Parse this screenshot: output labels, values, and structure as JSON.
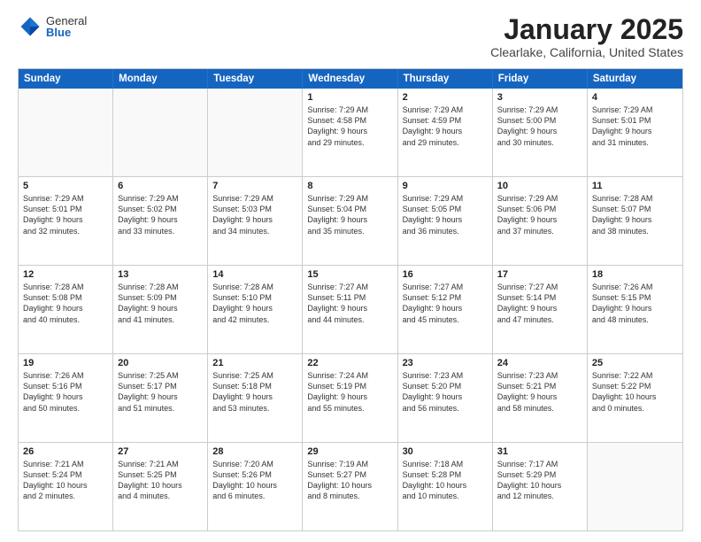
{
  "header": {
    "logo_general": "General",
    "logo_blue": "Blue",
    "month_year": "January 2025",
    "location": "Clearlake, California, United States"
  },
  "weekdays": [
    "Sunday",
    "Monday",
    "Tuesday",
    "Wednesday",
    "Thursday",
    "Friday",
    "Saturday"
  ],
  "rows": [
    [
      {
        "day": "",
        "text": ""
      },
      {
        "day": "",
        "text": ""
      },
      {
        "day": "",
        "text": ""
      },
      {
        "day": "1",
        "text": "Sunrise: 7:29 AM\nSunset: 4:58 PM\nDaylight: 9 hours\nand 29 minutes."
      },
      {
        "day": "2",
        "text": "Sunrise: 7:29 AM\nSunset: 4:59 PM\nDaylight: 9 hours\nand 29 minutes."
      },
      {
        "day": "3",
        "text": "Sunrise: 7:29 AM\nSunset: 5:00 PM\nDaylight: 9 hours\nand 30 minutes."
      },
      {
        "day": "4",
        "text": "Sunrise: 7:29 AM\nSunset: 5:01 PM\nDaylight: 9 hours\nand 31 minutes."
      }
    ],
    [
      {
        "day": "5",
        "text": "Sunrise: 7:29 AM\nSunset: 5:01 PM\nDaylight: 9 hours\nand 32 minutes."
      },
      {
        "day": "6",
        "text": "Sunrise: 7:29 AM\nSunset: 5:02 PM\nDaylight: 9 hours\nand 33 minutes."
      },
      {
        "day": "7",
        "text": "Sunrise: 7:29 AM\nSunset: 5:03 PM\nDaylight: 9 hours\nand 34 minutes."
      },
      {
        "day": "8",
        "text": "Sunrise: 7:29 AM\nSunset: 5:04 PM\nDaylight: 9 hours\nand 35 minutes."
      },
      {
        "day": "9",
        "text": "Sunrise: 7:29 AM\nSunset: 5:05 PM\nDaylight: 9 hours\nand 36 minutes."
      },
      {
        "day": "10",
        "text": "Sunrise: 7:29 AM\nSunset: 5:06 PM\nDaylight: 9 hours\nand 37 minutes."
      },
      {
        "day": "11",
        "text": "Sunrise: 7:28 AM\nSunset: 5:07 PM\nDaylight: 9 hours\nand 38 minutes."
      }
    ],
    [
      {
        "day": "12",
        "text": "Sunrise: 7:28 AM\nSunset: 5:08 PM\nDaylight: 9 hours\nand 40 minutes."
      },
      {
        "day": "13",
        "text": "Sunrise: 7:28 AM\nSunset: 5:09 PM\nDaylight: 9 hours\nand 41 minutes."
      },
      {
        "day": "14",
        "text": "Sunrise: 7:28 AM\nSunset: 5:10 PM\nDaylight: 9 hours\nand 42 minutes."
      },
      {
        "day": "15",
        "text": "Sunrise: 7:27 AM\nSunset: 5:11 PM\nDaylight: 9 hours\nand 44 minutes."
      },
      {
        "day": "16",
        "text": "Sunrise: 7:27 AM\nSunset: 5:12 PM\nDaylight: 9 hours\nand 45 minutes."
      },
      {
        "day": "17",
        "text": "Sunrise: 7:27 AM\nSunset: 5:14 PM\nDaylight: 9 hours\nand 47 minutes."
      },
      {
        "day": "18",
        "text": "Sunrise: 7:26 AM\nSunset: 5:15 PM\nDaylight: 9 hours\nand 48 minutes."
      }
    ],
    [
      {
        "day": "19",
        "text": "Sunrise: 7:26 AM\nSunset: 5:16 PM\nDaylight: 9 hours\nand 50 minutes."
      },
      {
        "day": "20",
        "text": "Sunrise: 7:25 AM\nSunset: 5:17 PM\nDaylight: 9 hours\nand 51 minutes."
      },
      {
        "day": "21",
        "text": "Sunrise: 7:25 AM\nSunset: 5:18 PM\nDaylight: 9 hours\nand 53 minutes."
      },
      {
        "day": "22",
        "text": "Sunrise: 7:24 AM\nSunset: 5:19 PM\nDaylight: 9 hours\nand 55 minutes."
      },
      {
        "day": "23",
        "text": "Sunrise: 7:23 AM\nSunset: 5:20 PM\nDaylight: 9 hours\nand 56 minutes."
      },
      {
        "day": "24",
        "text": "Sunrise: 7:23 AM\nSunset: 5:21 PM\nDaylight: 9 hours\nand 58 minutes."
      },
      {
        "day": "25",
        "text": "Sunrise: 7:22 AM\nSunset: 5:22 PM\nDaylight: 10 hours\nand 0 minutes."
      }
    ],
    [
      {
        "day": "26",
        "text": "Sunrise: 7:21 AM\nSunset: 5:24 PM\nDaylight: 10 hours\nand 2 minutes."
      },
      {
        "day": "27",
        "text": "Sunrise: 7:21 AM\nSunset: 5:25 PM\nDaylight: 10 hours\nand 4 minutes."
      },
      {
        "day": "28",
        "text": "Sunrise: 7:20 AM\nSunset: 5:26 PM\nDaylight: 10 hours\nand 6 minutes."
      },
      {
        "day": "29",
        "text": "Sunrise: 7:19 AM\nSunset: 5:27 PM\nDaylight: 10 hours\nand 8 minutes."
      },
      {
        "day": "30",
        "text": "Sunrise: 7:18 AM\nSunset: 5:28 PM\nDaylight: 10 hours\nand 10 minutes."
      },
      {
        "day": "31",
        "text": "Sunrise: 7:17 AM\nSunset: 5:29 PM\nDaylight: 10 hours\nand 12 minutes."
      },
      {
        "day": "",
        "text": ""
      }
    ]
  ]
}
